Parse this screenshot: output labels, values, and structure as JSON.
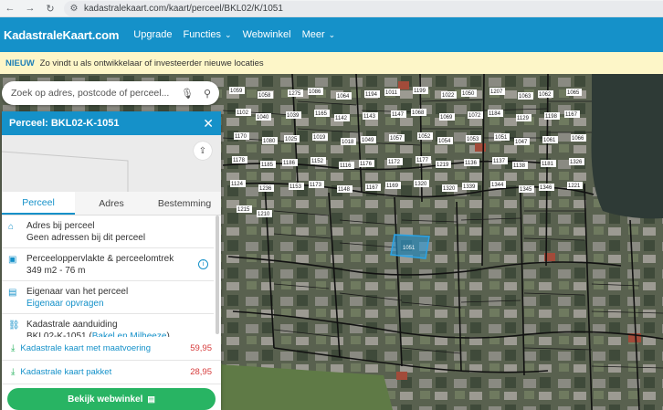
{
  "browser": {
    "url": "kadastralekaart.com/kaart/perceel/BKL02/K/1051"
  },
  "header": {
    "logo": "KadastraleKaart.com",
    "menu": [
      {
        "label": "Upgrade",
        "dropdown": false
      },
      {
        "label": "Functies",
        "dropdown": true
      },
      {
        "label": "Webwinkel",
        "dropdown": false
      },
      {
        "label": "Meer",
        "dropdown": true
      }
    ]
  },
  "news": {
    "tag": "NIEUW",
    "text": "Zo vindt u als ontwikkelaar of investeerder nieuwe locaties"
  },
  "search": {
    "placeholder": "Zoek op adres, postcode of perceel..."
  },
  "panel": {
    "title": "Perceel: BKL02-K-1051",
    "tabs": [
      "Perceel",
      "Adres",
      "Bestemming"
    ],
    "active_tab": "Perceel",
    "rows": [
      {
        "icon": "house-icon",
        "label": "Adres bij perceel",
        "value": "Geen adressen bij dit perceel"
      },
      {
        "icon": "area-icon",
        "label": "Perceeloppervlakte & perceelomtrek",
        "value": "349 m2 - 76 m"
      },
      {
        "icon": "document-icon",
        "label": "Eigenaar van het perceel",
        "value": "Eigenaar opvragen"
      },
      {
        "icon": "link-icon",
        "label": "Kadastrale aanduiding",
        "value": "BKL02-K-1051",
        "value_link": "Bakel en Milheeze"
      }
    ],
    "products": [
      {
        "name": "Kadastrale kaart met maatvoering",
        "price": "59,95"
      },
      {
        "name": "Kadastrale kaart pakket",
        "price": "28,95"
      }
    ],
    "cta": "Bekijk webwinkel"
  },
  "map": {
    "selected_parcel": "1051",
    "parcel_labels": [
      "1059",
      "1058",
      "1275",
      "1086",
      "1064",
      "1194",
      "1011",
      "1199",
      "1022",
      "1050",
      "1207",
      "1063",
      "1062",
      "1065",
      "1102",
      "1040",
      "1039",
      "1165",
      "1142",
      "1143",
      "1147",
      "1068",
      "1069",
      "1072",
      "1184",
      "1129",
      "1198",
      "1167",
      "1170",
      "1080",
      "1025",
      "1019",
      "1018",
      "1049",
      "1057",
      "1052",
      "1054",
      "1053",
      "1051",
      "1047",
      "1061",
      "1066",
      "1178",
      "1185",
      "1186",
      "1152",
      "1116",
      "1176",
      "1172",
      "1177",
      "1219",
      "1136",
      "1137",
      "1138",
      "1181",
      "1326",
      "1124",
      "1236",
      "1153",
      "1173",
      "1148",
      "1167",
      "1169",
      "1320",
      "1320",
      "1339",
      "1344",
      "1345",
      "1346",
      "1221",
      "1215",
      "1210"
    ]
  }
}
